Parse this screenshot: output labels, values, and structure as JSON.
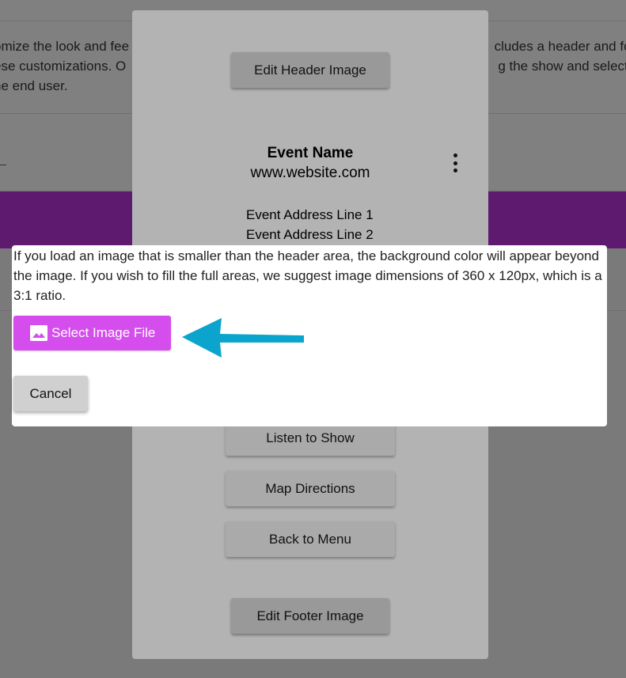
{
  "background": {
    "desc_lines": [
      {
        "left": "omize the look and fee",
        "right": "cludes a header and foo"
      },
      {
        "left": "ese customizations. O",
        "right": "g the show and selectin"
      },
      {
        "left": "he end user.",
        "right": ""
      }
    ],
    "colors": {
      "brand_purple": "#5e1a6e"
    }
  },
  "preview": {
    "edit_header_label": "Edit Header Image",
    "event_name": "Event Name",
    "website": "www.website.com",
    "address_line1": "Event Address Line 1",
    "address_line2": "Event Address Line 2",
    "buttons": [
      {
        "label": "Listen to Show"
      },
      {
        "label": "Map Directions"
      },
      {
        "label": "Back to Menu"
      }
    ],
    "edit_footer_label": "Edit Footer Image"
  },
  "dialog": {
    "message": "If you load an image that is smaller than the header area, the background color will appear beyond the image. If you wish to fill the full areas, we suggest image dimensions of 360 x 120px, which is a 3:1 ratio.",
    "select_label": "Select Image File",
    "select_icon": "image-icon",
    "cancel_label": "Cancel",
    "colors": {
      "select_button": "#d54ded",
      "arrow": "#0aa4cc"
    }
  }
}
